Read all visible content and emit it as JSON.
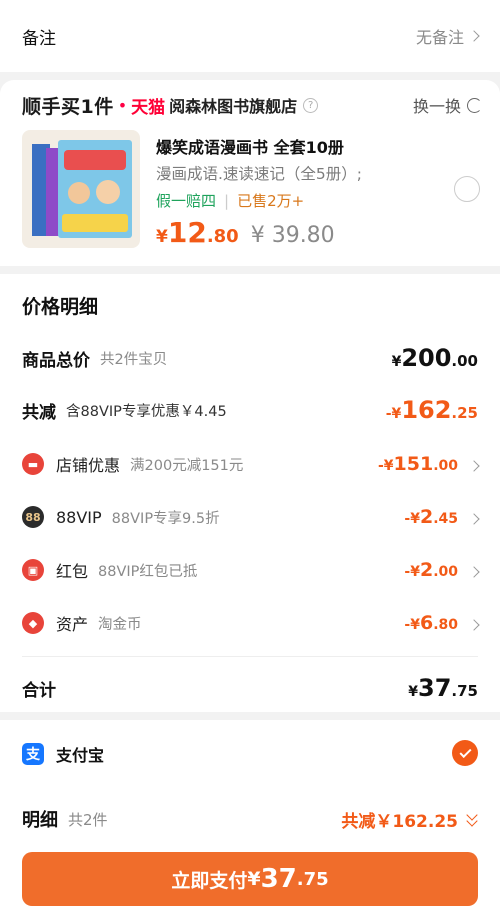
{
  "remark": {
    "label": "备注",
    "value": "无备注"
  },
  "promo": {
    "brand": "顺手买1件",
    "tmall": "天猫",
    "shop": "阅森林图书旗舰店",
    "swap_label": "换一换",
    "product": {
      "title": "爆笑成语漫画书 全套10册",
      "subtitle": "漫画成语.速读速记（全5册）;",
      "tag_guarantee": "假一赔四",
      "tag_sold": "已售2万+",
      "price_currency": "¥",
      "price_int": "12",
      "price_dec": ".80",
      "original_price": "¥ 39.80"
    }
  },
  "detail": {
    "title": "价格明细",
    "goods_total": {
      "label": "商品总价",
      "note": "共2件宝贝",
      "cur": "¥",
      "int": "200",
      "dec": ".00"
    },
    "total_discount": {
      "label": "共减",
      "note": "含88VIP专享优惠￥4.45",
      "cur": "-¥",
      "int": "162",
      "dec": ".25"
    },
    "items": [
      {
        "icon": "shop-icon",
        "color": "#e8443a",
        "label": "店铺优惠",
        "note": "满200元减151元",
        "cur": "-¥",
        "int": "151",
        "dec": ".00"
      },
      {
        "icon": "vip-icon",
        "color": "#2b2b2b",
        "label": "88VIP",
        "note": "88VIP专享9.5折",
        "cur": "-¥",
        "int": "2",
        "dec": ".45"
      },
      {
        "icon": "redpacket-icon",
        "color": "#e8443a",
        "label": "红包",
        "note": "88VIP红包已抵",
        "cur": "-¥",
        "int": "2",
        "dec": ".00"
      },
      {
        "icon": "asset-icon",
        "color": "#e8443a",
        "label": "资产",
        "note": "淘金币",
        "cur": "-¥",
        "int": "6",
        "dec": ".80"
      }
    ],
    "total": {
      "label": "合计",
      "cur": "¥",
      "int": "37",
      "dec": ".75"
    }
  },
  "payment": {
    "method": "支付宝",
    "alipay_glyph": "支",
    "vip_glyph": "88",
    "detail_label": "明细",
    "detail_count": "共2件",
    "detail_discount": "共减￥162.25",
    "pay_button": {
      "action": "立即支付",
      "cur": "¥",
      "int": "37",
      "dec": ".75"
    }
  },
  "colors": {
    "accent": "#f25a17",
    "button": "#f06d2b",
    "alipay": "#1677ff",
    "green": "#1fa35c"
  }
}
